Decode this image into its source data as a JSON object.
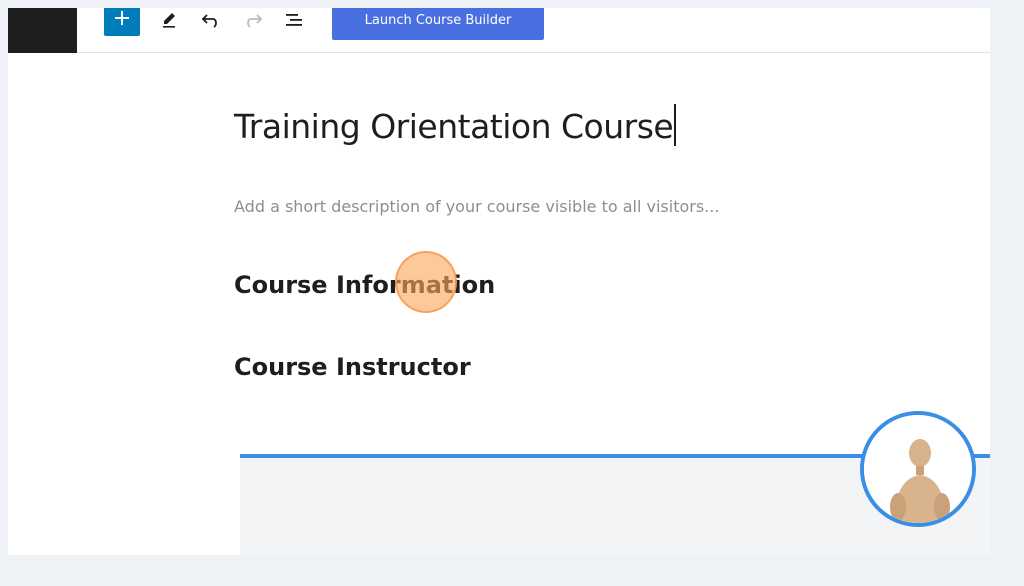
{
  "toolbar": {
    "add_icon": "plus-icon",
    "tools": [
      "pencil-icon",
      "undo-icon",
      "redo-icon",
      "list-view-icon"
    ],
    "launch_button_label": "Launch Course Builder",
    "colors": {
      "add_button": "#007cba",
      "launch_button": "#4a6fe0"
    }
  },
  "editor": {
    "title": "Training Orientation Course",
    "description_placeholder": "Add a short description of your course visible to all visitors...",
    "headings": [
      "Course Information",
      "Course Instructor"
    ]
  },
  "colors": {
    "accent_blue": "#3b8ee6",
    "click_marker": "#fba85c"
  },
  "overlay": {
    "avatar_icon": "wooden-mannequin-avatar"
  }
}
